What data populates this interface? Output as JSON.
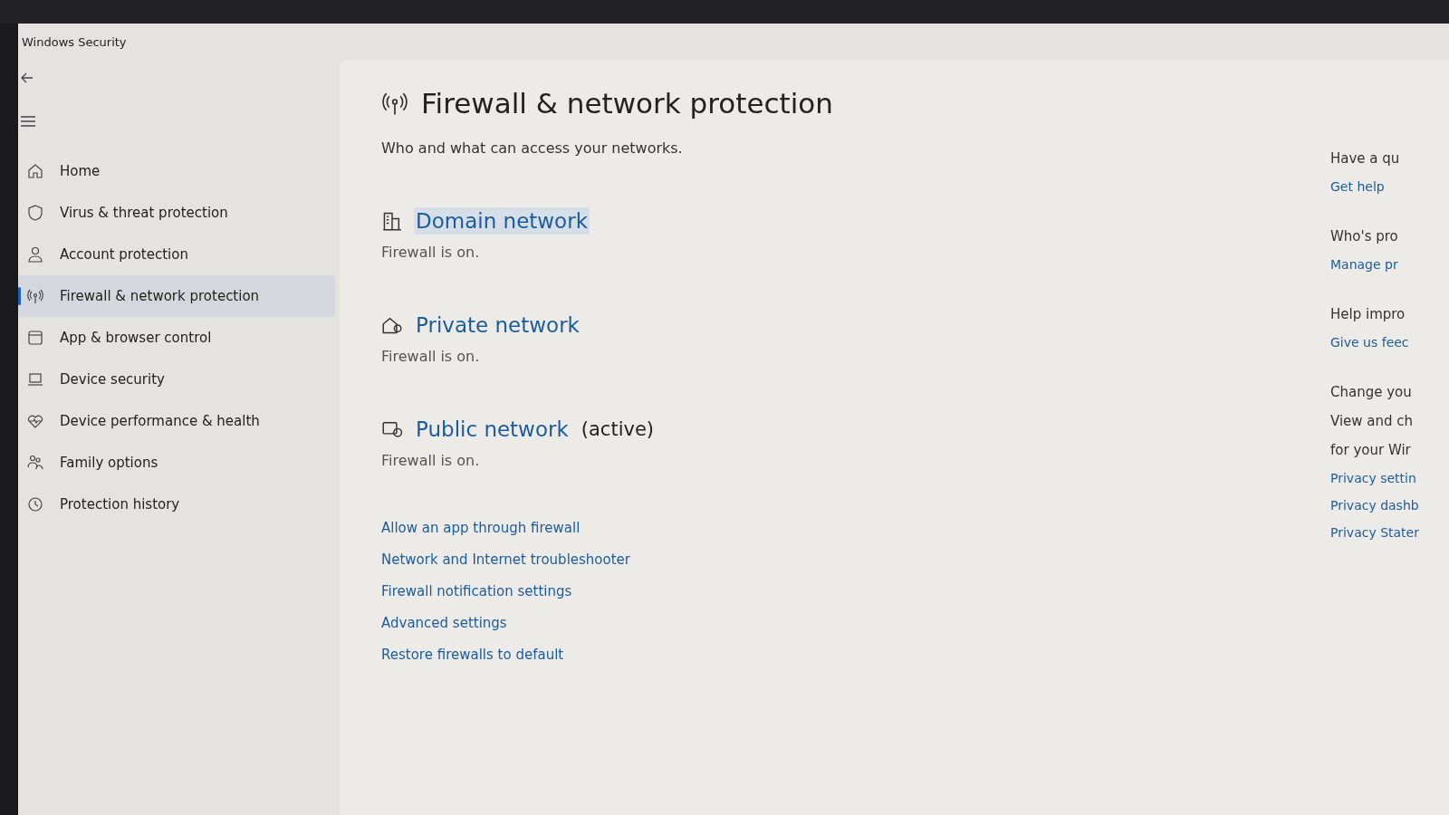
{
  "window": {
    "title": "Windows Security"
  },
  "sidebar": {
    "items": [
      {
        "label": "Home",
        "selected": false
      },
      {
        "label": "Virus & threat protection",
        "selected": false
      },
      {
        "label": "Account protection",
        "selected": false
      },
      {
        "label": "Firewall & network protection",
        "selected": true
      },
      {
        "label": "App & browser control",
        "selected": false
      },
      {
        "label": "Device security",
        "selected": false
      },
      {
        "label": "Device performance & health",
        "selected": false
      },
      {
        "label": "Family options",
        "selected": false
      },
      {
        "label": "Protection history",
        "selected": false
      }
    ]
  },
  "page": {
    "title": "Firewall & network protection",
    "subtitle": "Who and what can access your networks.",
    "networks": [
      {
        "name": "Domain network",
        "status": "Firewall is on.",
        "hovered": true
      },
      {
        "name": "Private network",
        "status": "Firewall is on.",
        "hovered": false
      },
      {
        "name": "Public network",
        "tag": "(active)",
        "status": "Firewall is on.",
        "hovered": false
      }
    ],
    "links": [
      "Allow an app through firewall",
      "Network and Internet troubleshooter",
      "Firewall notification settings",
      "Advanced settings",
      "Restore firewalls to default"
    ]
  },
  "aside": {
    "sections": [
      {
        "heading": "Have a qu",
        "links": [
          "Get help"
        ]
      },
      {
        "heading": "Who's pro",
        "links": [
          "Manage pr"
        ]
      },
      {
        "heading": "Help impro",
        "links": [
          "Give us feec"
        ]
      },
      {
        "heading": "Change you",
        "lines": [
          "View and ch",
          "for your Wir"
        ],
        "links": [
          "Privacy settin",
          "Privacy dashb",
          "Privacy Stater"
        ]
      }
    ]
  }
}
